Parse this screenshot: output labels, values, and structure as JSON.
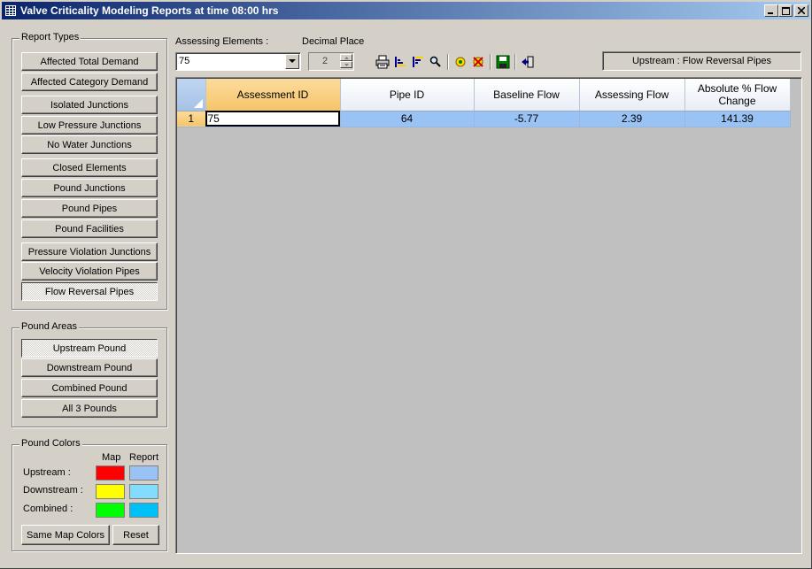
{
  "window": {
    "title": "Valve Criticality Modeling Reports at time 08:00 hrs",
    "icon": "grid-app-icon"
  },
  "report_types": {
    "legend": "Report Types",
    "buttons": [
      "Affected Total Demand",
      "Affected Category Demand",
      "Isolated Junctions",
      "Low Pressure Junctions",
      "No Water Junctions",
      "Closed Elements",
      "Pound Junctions",
      "Pound Pipes",
      "Pound Facilities",
      "Pressure Violation Junctions",
      "Velocity Violation Pipes",
      "Flow Reversal Pipes"
    ],
    "selected": "Flow Reversal Pipes"
  },
  "pound_areas": {
    "legend": "Pound Areas",
    "buttons": [
      "Upstream Pound",
      "Downstream Pound",
      "Combined Pound",
      "All 3 Pounds"
    ],
    "selected": "Upstream Pound"
  },
  "pound_colors": {
    "legend": "Pound Colors",
    "col_map": "Map",
    "col_report": "Report",
    "rows": [
      {
        "label": "Upstream :",
        "map_color": "#ff0000",
        "report_color": "#99c2f5"
      },
      {
        "label": "Downstream :",
        "map_color": "#ffff00",
        "report_color": "#84dcfc"
      },
      {
        "label": "Combined :",
        "map_color": "#00ff00",
        "report_color": "#00c0f8"
      }
    ],
    "same_map_colors_label": "Same Map Colors",
    "reset_label": "Reset"
  },
  "controls": {
    "assessing_elements_label": "Assessing Elements :",
    "assessing_elements_value": "75",
    "decimal_place_label": "Decimal Place",
    "decimal_place_value": "2"
  },
  "toolbar_icons": [
    "print-icon",
    "sort-ascending-icon",
    "sort-descending-icon",
    "find-icon",
    "locate-icon",
    "clear-locate-icon",
    "save-icon",
    "exit-icon"
  ],
  "status_text": "Upstream : Flow Reversal Pipes",
  "grid": {
    "columns": [
      "Assessment ID",
      "Pipe ID",
      "Baseline Flow",
      "Assessing Flow",
      "Absolute % Flow Change"
    ],
    "rows": [
      {
        "row_no": "1",
        "cells": [
          "75",
          "64",
          "-5.77",
          "2.39",
          "141.39"
        ]
      }
    ]
  }
}
